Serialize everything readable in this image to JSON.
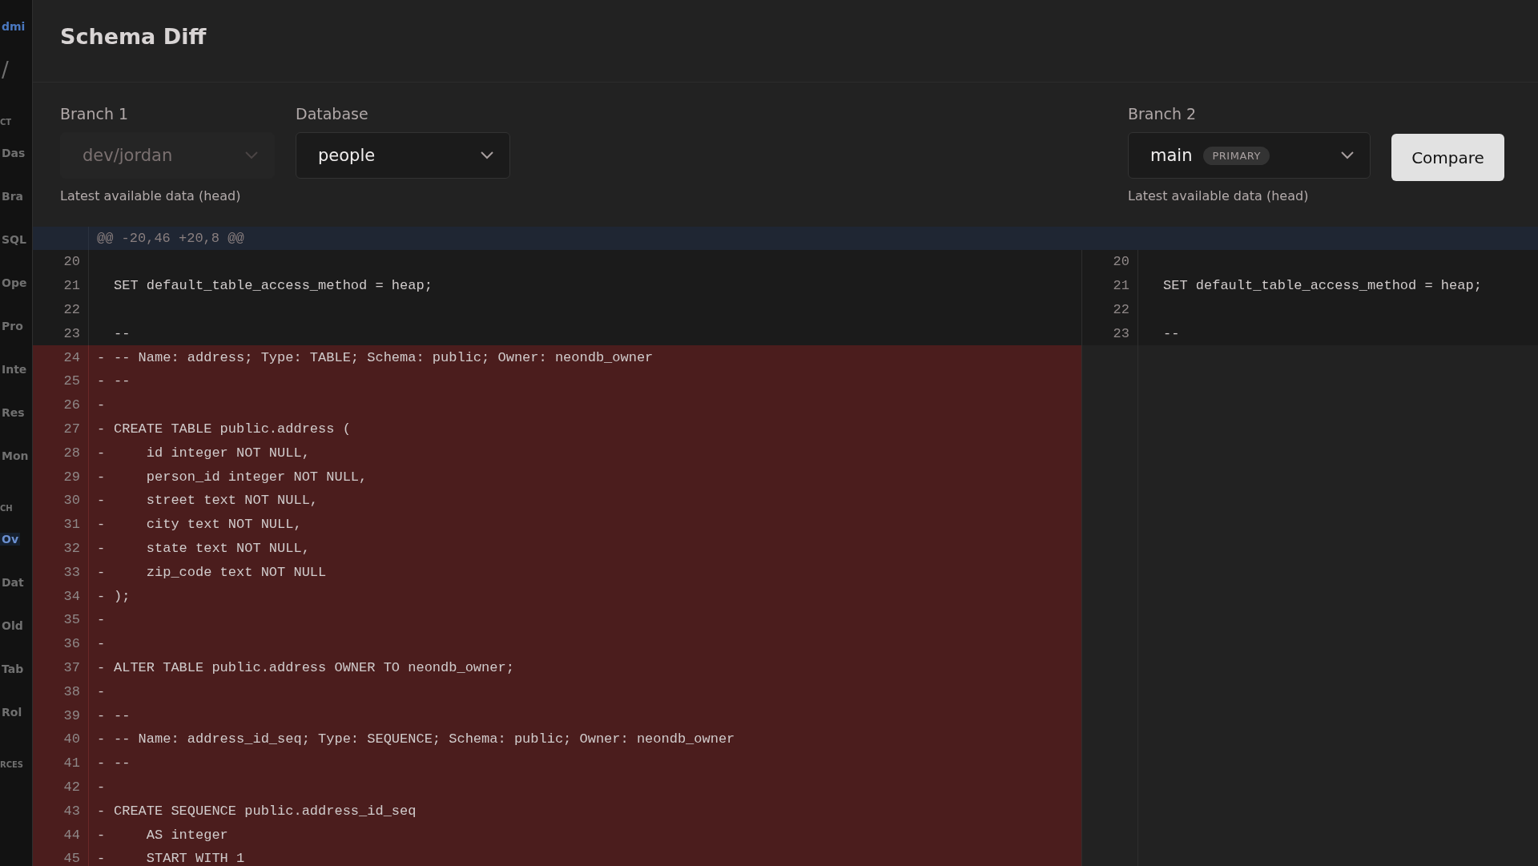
{
  "backdrop_sidebar": {
    "items": [
      {
        "kind": "brand",
        "label": "dmi",
        "selected": false
      },
      {
        "kind": "divider",
        "label": "/",
        "selected": false
      },
      {
        "kind": "section",
        "label": "CT",
        "selected": false
      },
      {
        "kind": "item",
        "label": "Das",
        "selected": false
      },
      {
        "kind": "item",
        "label": "Bra",
        "selected": false
      },
      {
        "kind": "item",
        "label": "SQL",
        "selected": false
      },
      {
        "kind": "item",
        "label": "Ope",
        "selected": false
      },
      {
        "kind": "item",
        "label": "Pro",
        "selected": false
      },
      {
        "kind": "item",
        "label": "Inte",
        "selected": false
      },
      {
        "kind": "item",
        "label": "Res",
        "selected": false
      },
      {
        "kind": "item",
        "label": "Mon",
        "selected": false
      },
      {
        "kind": "section",
        "label": "CH",
        "selected": false
      },
      {
        "kind": "item",
        "label": "Ov",
        "selected": true
      },
      {
        "kind": "item",
        "label": "Dat",
        "selected": false
      },
      {
        "kind": "item",
        "label": "Old",
        "selected": false
      },
      {
        "kind": "item",
        "label": "Tab",
        "selected": false
      },
      {
        "kind": "item",
        "label": "Rol",
        "selected": false
      },
      {
        "kind": "section",
        "label": "RCES",
        "selected": false
      }
    ]
  },
  "dialog": {
    "title": "Schema Diff",
    "branch_1": {
      "label": "Branch 1",
      "value": "dev/jordan",
      "disabled": true,
      "hint": "Latest available data (head)"
    },
    "database": {
      "label": "Database",
      "value": "people",
      "disabled": false
    },
    "branch_2": {
      "label": "Branch 2",
      "value": "main",
      "badge": "PRIMARY",
      "disabled": false,
      "hint": "Latest available data (head)"
    },
    "compare_button": "Compare"
  },
  "diff": {
    "hunk_header": "@@ -20,46 +20,8 @@",
    "rows": [
      {
        "kind": "context",
        "left_num": "20",
        "right_num": "20"
      },
      {
        "kind": "context",
        "left_num": "21",
        "right_num": "21",
        "text": "SET default_table_access_method = heap;",
        "right_text": "SET default_table_access_method = heap;"
      },
      {
        "kind": "context",
        "left_num": "22",
        "right_num": "22"
      },
      {
        "kind": "context",
        "left_num": "23",
        "right_num": "23",
        "text": "--",
        "right_text": "--"
      },
      {
        "kind": "removed",
        "left_num": "24",
        "marker": "-",
        "text": "-- Name: address; Type: TABLE; Schema: public; Owner: neondb_owner"
      },
      {
        "kind": "removed",
        "left_num": "25",
        "marker": "-",
        "text": "--"
      },
      {
        "kind": "removed",
        "left_num": "26",
        "marker": "-"
      },
      {
        "kind": "removed",
        "left_num": "27",
        "marker": "-",
        "text": "CREATE TABLE public.address ("
      },
      {
        "kind": "removed",
        "left_num": "28",
        "marker": "-",
        "text": "    id integer NOT NULL,"
      },
      {
        "kind": "removed",
        "left_num": "29",
        "marker": "-",
        "text": "    person_id integer NOT NULL,"
      },
      {
        "kind": "removed",
        "left_num": "30",
        "marker": "-",
        "text": "    street text NOT NULL,"
      },
      {
        "kind": "removed",
        "left_num": "31",
        "marker": "-",
        "text": "    city text NOT NULL,"
      },
      {
        "kind": "removed",
        "left_num": "32",
        "marker": "-",
        "text": "    state text NOT NULL,"
      },
      {
        "kind": "removed",
        "left_num": "33",
        "marker": "-",
        "text": "    zip_code text NOT NULL"
      },
      {
        "kind": "removed",
        "left_num": "34",
        "marker": "-",
        "text": ");"
      },
      {
        "kind": "removed",
        "left_num": "35",
        "marker": "-"
      },
      {
        "kind": "removed",
        "left_num": "36",
        "marker": "-"
      },
      {
        "kind": "removed",
        "left_num": "37",
        "marker": "-",
        "text": "ALTER TABLE public.address OWNER TO neondb_owner;"
      },
      {
        "kind": "removed",
        "left_num": "38",
        "marker": "-"
      },
      {
        "kind": "removed",
        "left_num": "39",
        "marker": "-",
        "text": "--"
      },
      {
        "kind": "removed",
        "left_num": "40",
        "marker": "-",
        "text": "-- Name: address_id_seq; Type: SEQUENCE; Schema: public; Owner: neondb_owner"
      },
      {
        "kind": "removed",
        "left_num": "41",
        "marker": "-",
        "text": "--"
      },
      {
        "kind": "removed",
        "left_num": "42",
        "marker": "-"
      },
      {
        "kind": "removed",
        "left_num": "43",
        "marker": "-",
        "text": "CREATE SEQUENCE public.address_id_seq"
      },
      {
        "kind": "removed",
        "left_num": "44",
        "marker": "-",
        "text": "    AS integer"
      },
      {
        "kind": "removed",
        "left_num": "45",
        "marker": "-",
        "text": "    START WITH 1"
      }
    ]
  }
}
